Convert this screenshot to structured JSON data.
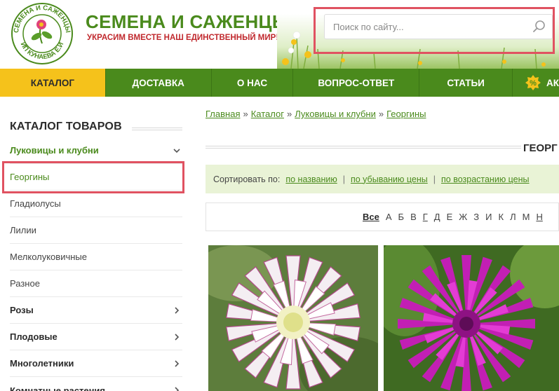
{
  "header": {
    "site_title": "СЕМЕНА И САЖЕНЦЫ",
    "slogan": "УКРАСИМ ВМЕСТЕ НАШ ЕДИНСТВЕННЫЙ МИР!",
    "logo_text_top": "СЕМЕНА И САЖЕНЦЫ",
    "logo_text_bottom": "ИП КУНАЕВА Е.И",
    "search_placeholder": "Поиск по сайту..."
  },
  "nav": {
    "items": [
      {
        "label": "КАТАЛОГ",
        "active": true
      },
      {
        "label": "ДОСТАВКА"
      },
      {
        "label": "О НАС"
      },
      {
        "label": "ВОПРОС-ОТВЕТ"
      },
      {
        "label": "СТАТЬИ"
      }
    ],
    "sale_label": "АК"
  },
  "sidebar": {
    "title": "КАТАЛОГ ТОВАРОВ",
    "items": [
      {
        "label": "Луковицы и клубни"
      },
      {
        "label": "Георгины"
      },
      {
        "label": "Гладиолусы"
      },
      {
        "label": "Лилии"
      },
      {
        "label": "Мелколуковичные"
      },
      {
        "label": "Разное"
      },
      {
        "label": "Розы"
      },
      {
        "label": "Плодовые"
      },
      {
        "label": "Многолетники"
      },
      {
        "label": "Комнатные растения"
      }
    ]
  },
  "breadcrumb": {
    "items": [
      "Главная",
      "Каталог",
      "Луковицы и клубни",
      "Георгины"
    ],
    "separator": "»"
  },
  "page_title": "ГЕОРГ",
  "sort": {
    "label": "Сортировать по:",
    "options": [
      "по названию",
      "по убыванию цены",
      "по возрастанию цены"
    ]
  },
  "alphabet": [
    "Все",
    "А",
    "Б",
    "В",
    "Г",
    "Д",
    "Е",
    "Ж",
    "З",
    "И",
    "К",
    "Л",
    "М",
    "Н"
  ],
  "colors": {
    "brand_green": "#4a8a1c",
    "nav_active": "#f5c21b",
    "highlight": "#e05261",
    "slogan_red": "#c0282d",
    "sort_bg": "#e9f3d6"
  }
}
